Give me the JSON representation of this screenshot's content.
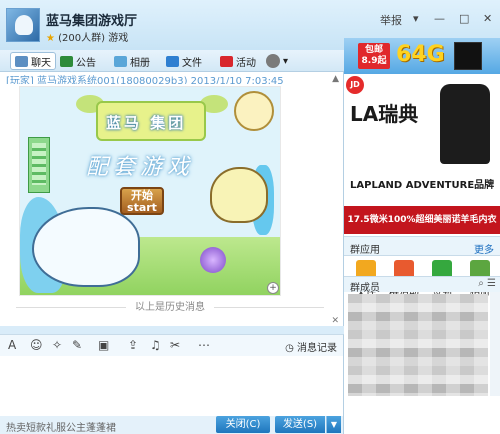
{
  "header": {
    "group_name": "蓝马集团游戏厅",
    "group_meta": "(200人群) 游戏",
    "report_label": "举报",
    "dropdown_arrow": "▾",
    "minimize": "—",
    "maximize": "□",
    "close": "✕"
  },
  "toolbar": {
    "tabs": [
      "聊天",
      "公告",
      "相册",
      "文件",
      "活动"
    ],
    "more": "▾"
  },
  "chat": {
    "sender_line": "[玩家] 蓝马游戏系统001(18080029b3) 2013/1/10 7:03:45",
    "poster_title": "蓝马 集团",
    "poster_sub": "配套游戏",
    "start_line1": "开始",
    "start_line2": "start",
    "history_label": "以上是历史消息"
  },
  "input_toolbar": {
    "record_label": "消息记录"
  },
  "bottom": {
    "ad_text": "热卖短款礼服公主蓬蓬裙",
    "close_button": "关闭(C)",
    "send_button": "发送(S)"
  },
  "right": {
    "ad1_badge_line1": "包邮",
    "ad1_badge_line2": "8.9起",
    "ad1_size": "64G",
    "ad2_logo": "JD",
    "ad2_brand": "LA瑞典",
    "ad2_slogan": "LAPLAND ADVENTURE品牌",
    "ad2_offer": "17.5微米100%超细美丽诺羊毛内衣",
    "apps_title": "群应用",
    "apps_more": "更多",
    "apps": [
      {
        "label": "文件",
        "color": "#f2a81f"
      },
      {
        "label": "群活动",
        "color": "#e85a2f"
      },
      {
        "label": "签到",
        "color": "#35a83e"
      },
      {
        "label": "相册",
        "color": "#5ca640"
      }
    ],
    "members_title": "群成员"
  }
}
